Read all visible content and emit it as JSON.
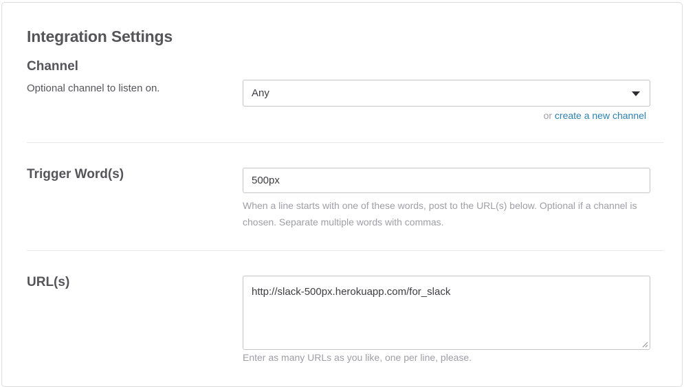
{
  "section": {
    "title": "Integration Settings"
  },
  "channel": {
    "label": "Channel",
    "description": "Optional channel to listen on.",
    "selected": "Any",
    "create_prefix": "or ",
    "create_link": "create a new channel"
  },
  "trigger": {
    "label": "Trigger Word(s)",
    "value": "500px",
    "help": "When a line starts with one of these words, post to the URL(s) below. Optional if a channel is chosen. Separate multiple words with commas."
  },
  "urls": {
    "label": "URL(s)",
    "value": "http://slack-500px.herokuapp.com/for_slack",
    "help": "Enter as many URLs as you like, one per line, please."
  },
  "colors": {
    "link": "#2a80b9",
    "heading": "#555459",
    "help_text": "#9e9ea6",
    "border": "#c5c5c5"
  }
}
